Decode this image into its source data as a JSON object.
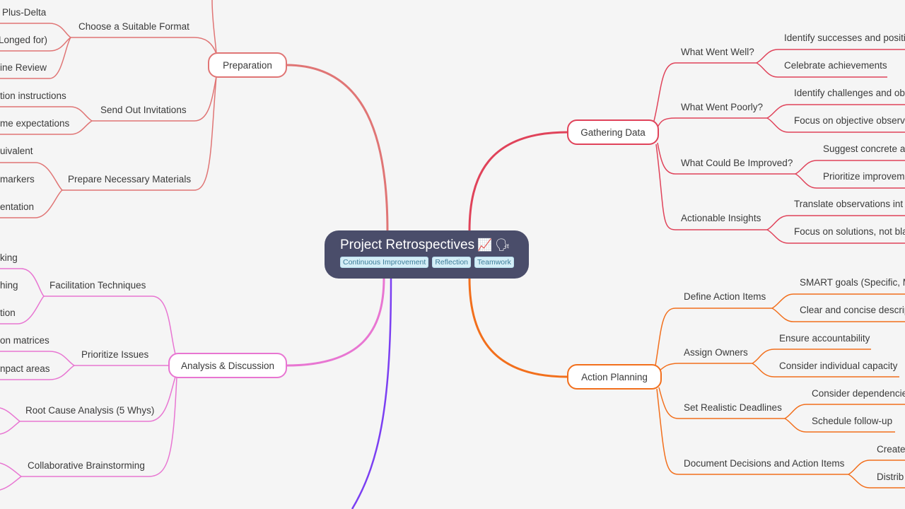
{
  "root": {
    "title": "Project Retrospectives",
    "icons": [
      "chart-increasing-icon",
      "speaking-head-icon"
    ],
    "icon_glyphs": [
      "📈",
      "🗣"
    ],
    "tags": [
      "Continuous Improvement",
      "Reflection",
      "Teamwork"
    ]
  },
  "colors": {
    "preparation": "#e07575",
    "gathering": "#e0435a",
    "analysis": "#e876d2",
    "action": "#f26f1c",
    "hidden_branch": "#7b3ff2",
    "root_bg": "#4a4d6a",
    "background": "#f5f5f5"
  },
  "branches": {
    "preparation": {
      "label": "Preparation",
      "children": [
        {
          "label": "Choose a Suitable Format",
          "items": [
            "Plus-Delta",
            "Longed for)",
            "ine Review"
          ]
        },
        {
          "label": "Send Out Invitations",
          "items": [
            "tion instructions",
            "me expectations"
          ]
        },
        {
          "label": "Prepare Necessary Materials",
          "items": [
            "uivalent",
            "markers",
            "entation"
          ]
        }
      ]
    },
    "gathering": {
      "label": "Gathering Data",
      "children": [
        {
          "label": "What Went Well?",
          "items": [
            "Identify successes and positi",
            "Celebrate achievements"
          ]
        },
        {
          "label": "What Went Poorly?",
          "items": [
            "Identify challenges and ob",
            "Focus on objective observa"
          ]
        },
        {
          "label": "What Could Be Improved?",
          "items": [
            "Suggest concrete ac",
            "Prioritize improvem"
          ]
        },
        {
          "label": "Actionable Insights",
          "items": [
            "Translate observations int",
            "Focus on solutions, not bla"
          ]
        }
      ]
    },
    "analysis": {
      "label": "Analysis & Discussion",
      "children": [
        {
          "label": "Facilitation Techniques",
          "items": [
            "king",
            "hing",
            "tion"
          ]
        },
        {
          "label": "Prioritize Issues",
          "items": [
            "on matrices",
            "npact areas"
          ]
        },
        {
          "label": "Root Cause Analysis (5 Whys)",
          "items": []
        },
        {
          "label": "Collaborative Brainstorming",
          "items": []
        }
      ]
    },
    "action": {
      "label": "Action Planning",
      "children": [
        {
          "label": "Define Action Items",
          "items": [
            "SMART goals (Specific, Me",
            "Clear and concise descrip"
          ]
        },
        {
          "label": "Assign Owners",
          "items": [
            "Ensure accountability",
            "Consider individual capacity"
          ]
        },
        {
          "label": "Set Realistic Deadlines",
          "items": [
            "Consider dependencie",
            "Schedule follow-up"
          ]
        },
        {
          "label": "Document Decisions and Action Items",
          "items": [
            "Create",
            "Distrib"
          ]
        }
      ]
    }
  }
}
